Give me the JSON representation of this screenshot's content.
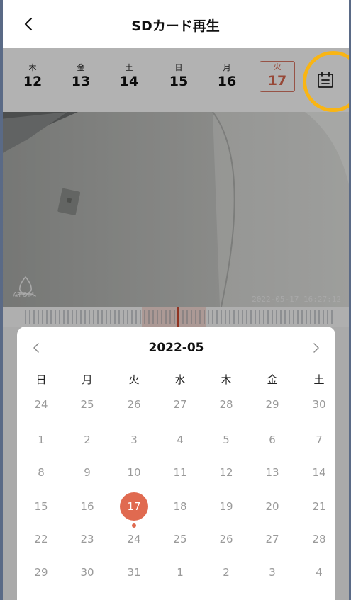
{
  "header": {
    "title": "SDカード再生",
    "back_icon": "chevron-left-icon"
  },
  "date_strip": {
    "days": [
      {
        "dow": "木",
        "num": "12"
      },
      {
        "dow": "金",
        "num": "13"
      },
      {
        "dow": "土",
        "num": "14"
      },
      {
        "dow": "日",
        "num": "15"
      },
      {
        "dow": "月",
        "num": "16"
      },
      {
        "dow": "火",
        "num": "17"
      }
    ],
    "selected_color": "#d9674f",
    "calendar_icon": "calendar-icon"
  },
  "video": {
    "logo_text": "ATOM",
    "timestamp": "2022-05-17 16:27:12"
  },
  "calendar": {
    "month_label": "2022-05",
    "weekdays": [
      "日",
      "月",
      "火",
      "水",
      "木",
      "金",
      "土"
    ],
    "weeks": [
      [
        "24",
        "25",
        "26",
        "27",
        "28",
        "29",
        "30"
      ],
      [
        "1",
        "2",
        "3",
        "4",
        "5",
        "6",
        "7"
      ],
      [
        "8",
        "9",
        "10",
        "11",
        "12",
        "13",
        "14"
      ],
      [
        "15",
        "16",
        "17",
        "18",
        "19",
        "20",
        "21"
      ],
      [
        "22",
        "23",
        "24",
        "25",
        "26",
        "27",
        "28"
      ],
      [
        "29",
        "30",
        "31",
        "1",
        "2",
        "3",
        "4"
      ]
    ],
    "selected_day": "17",
    "accent_color": "#e06a50",
    "highlight_color": "#f9b514"
  }
}
